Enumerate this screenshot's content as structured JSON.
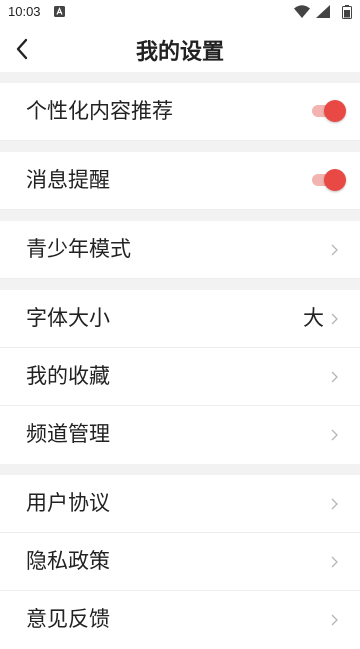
{
  "status_bar": {
    "time": "10:03"
  },
  "header": {
    "title": "我的设置"
  },
  "accent_color": "#e94944",
  "groups": [
    {
      "items": [
        {
          "label": "个性化内容推荐",
          "control": "toggle",
          "on": true
        }
      ]
    },
    {
      "items": [
        {
          "label": "消息提醒",
          "control": "toggle",
          "on": true
        }
      ]
    },
    {
      "items": [
        {
          "label": "青少年模式",
          "control": "chevron"
        }
      ]
    },
    {
      "items": [
        {
          "label": "字体大小",
          "control": "chevron",
          "value": "大"
        },
        {
          "label": "我的收藏",
          "control": "chevron"
        },
        {
          "label": "频道管理",
          "control": "chevron"
        }
      ]
    },
    {
      "items": [
        {
          "label": "用户协议",
          "control": "chevron"
        },
        {
          "label": "隐私政策",
          "control": "chevron"
        },
        {
          "label": "意见反馈",
          "control": "chevron"
        }
      ]
    }
  ]
}
